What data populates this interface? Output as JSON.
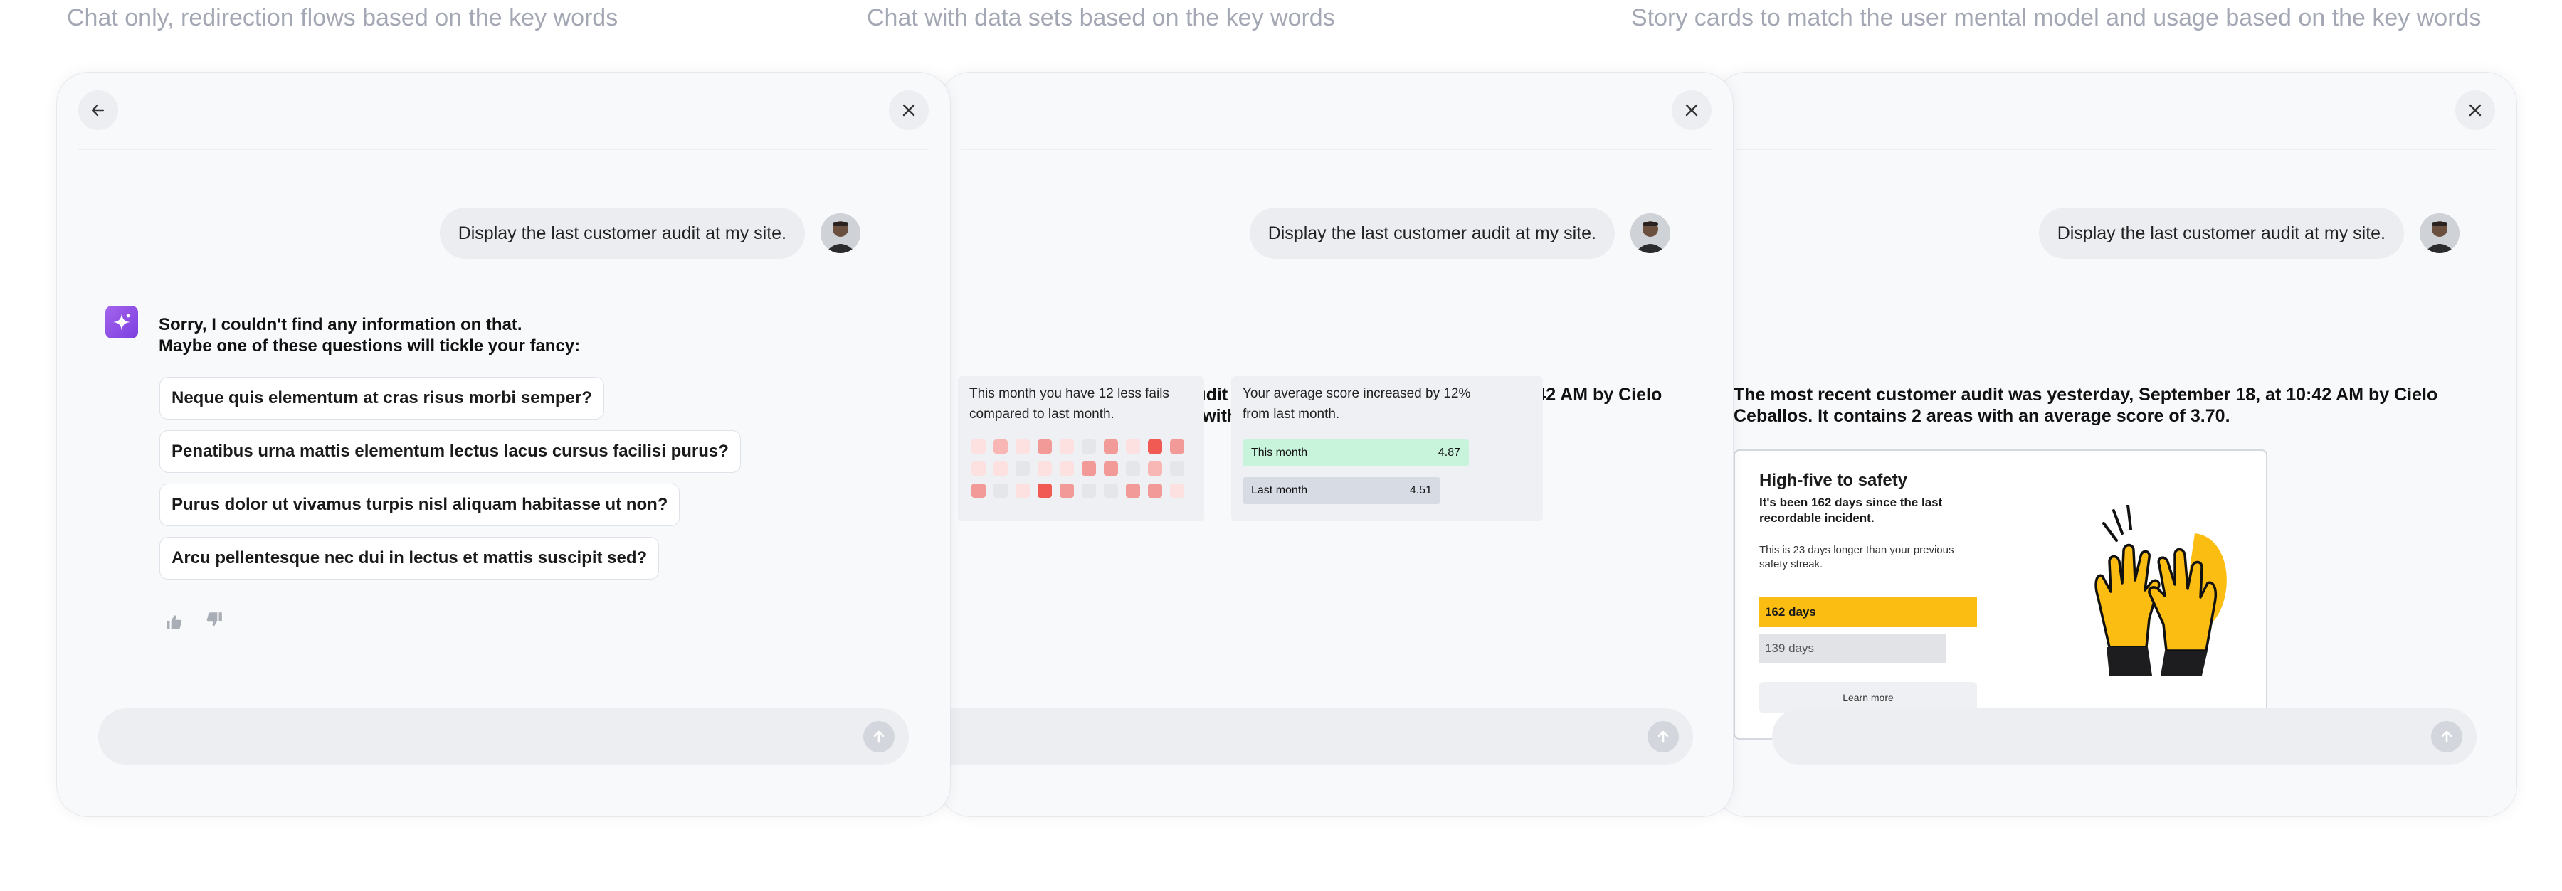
{
  "captions": [
    "Chat only, redirection flows based on the key words",
    "Chat with data sets based on the key words",
    "Story cards to match the user mental model and usage based on the key words"
  ],
  "user_message": "Display the last customer audit at my site.",
  "panel1": {
    "apology_line1": "Sorry, I couldn't find any information on that.",
    "apology_line2": "Maybe one of these questions will tickle your fancy:",
    "suggestions": [
      "Neque quis elementum at cras risus morbi semper?",
      "Penatibus urna mattis elementum lectus lacus cursus facilisi purus?",
      "Purus dolor ut vivamus turpis nisl aliquam habitasse ut non?",
      "Arcu pellentesque nec dui in lectus et mattis suscipit sed?"
    ]
  },
  "audit_answer": {
    "line1": "The most recent customer audit was yesterday, September 18, at 10:42 AM  by Cielo",
    "line2": "Ceballos. It contains 2 areas with an average score of 3.70."
  },
  "fails_card": {
    "line1": "This month you have 12 less fails",
    "line2": "compared to last month.",
    "heatmap": [
      [
        "#fde0e0",
        "#f8b7b5",
        "#fde0e0",
        "#f29a97",
        "#fde0e0",
        "#e4e6ea",
        "#f29a97",
        "#fde0e0",
        "#f05a52",
        "#f29a97"
      ],
      [
        "#fde0e0",
        "#fde0e0",
        "#e4e6ea",
        "#fde0e0",
        "#fde0e0",
        "#f29a97",
        "#f29a97",
        "#e4e6ea",
        "#f8b7b5",
        "#e4e6ea"
      ],
      [
        "#f29a97",
        "#e4e6ea",
        "#fde0e0",
        "#f05a52",
        "#f29a97",
        "#e4e6ea",
        "#e4e6ea",
        "#f29a97",
        "#f29a97",
        "#fde0e0"
      ]
    ]
  },
  "score_card": {
    "line1": "Your average score increased by 12%",
    "line2": "from last month.",
    "this_month_label": "This month",
    "this_month_value": "4.87",
    "last_month_label": "Last month",
    "last_month_value": "4.51",
    "this_month_color": "#c8f4dc",
    "last_month_color": "#d6dbe4"
  },
  "story_card": {
    "title": "High-five to safety",
    "subtitle_line1": "It's been 162 days since the last",
    "subtitle_line2": "recordable incident.",
    "body_line1": "This is 23 days longer than your previous",
    "body_line2": "safety streak.",
    "current_streak_label": "162 days",
    "previous_streak_label": "139 days",
    "current_streak_days": 162,
    "previous_streak_days": 139,
    "current_color": "#fbbd12",
    "previous_color": "#e1e3e7",
    "button_label": "Learn more",
    "illustration": "high-five-hands"
  },
  "colors": {
    "assistant_icon": "#8e4fe6",
    "panel_bg": "#f8f9fb",
    "caption": "#a3a8b4"
  }
}
